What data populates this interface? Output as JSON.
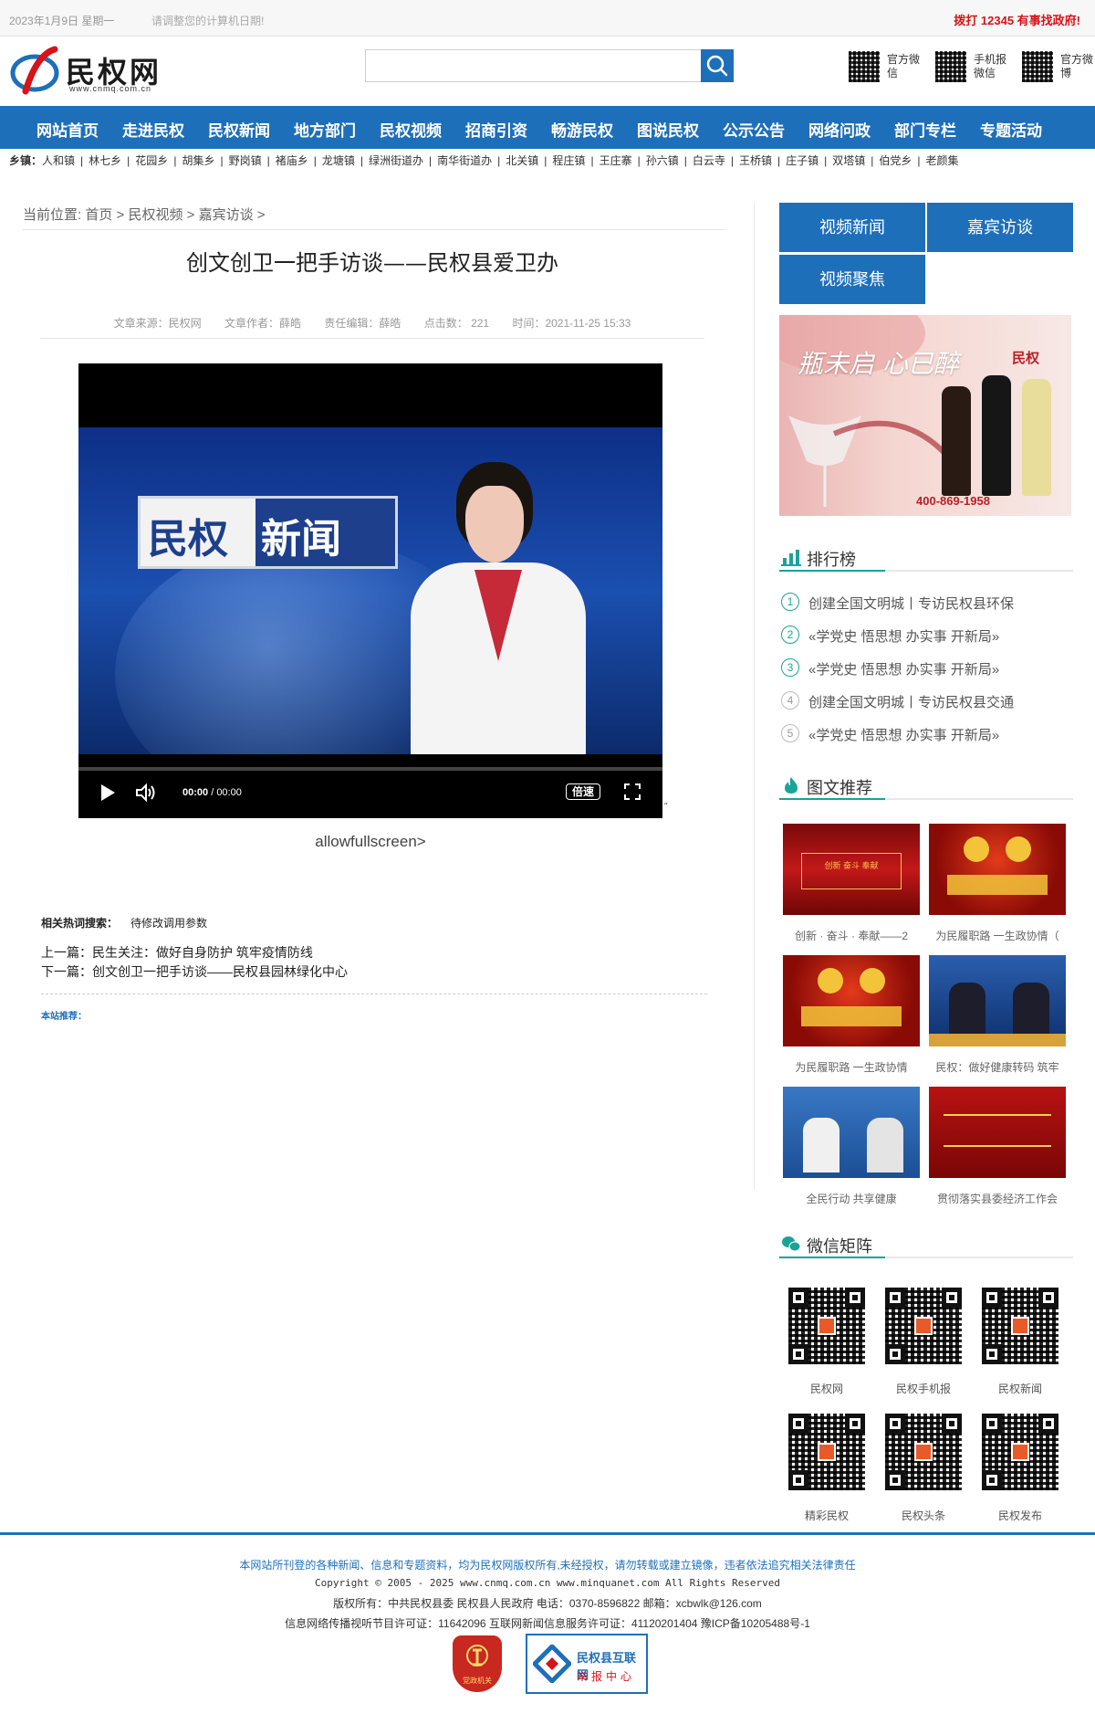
{
  "topbar": {
    "date": "2023年1月9日 星期一",
    "hint": "请调整您的计算机日期!",
    "hotline": "拨打 12345 有事找政府!"
  },
  "header": {
    "logo_text": "民权网",
    "logo_url": "www.cnmq.com.cn",
    "search_placeholder": "",
    "qr_links": [
      {
        "label": "官方微信"
      },
      {
        "label": "手机报微信"
      },
      {
        "label": "官方微博"
      }
    ]
  },
  "nav": {
    "items": [
      "网站首页",
      "走进民权",
      "民权新闻",
      "地方部门",
      "民权视频",
      "招商引资",
      "畅游民权",
      "图说民权",
      "公示公告",
      "网络问政",
      "部门专栏",
      "专题活动"
    ]
  },
  "towns": {
    "label": "乡镇：",
    "items": [
      "人和镇",
      "林七乡",
      "花园乡",
      "胡集乡",
      "野岗镇",
      "褚庙乡",
      "龙塘镇",
      "绿洲街道办",
      "南华街道办",
      "北关镇",
      "程庄镇",
      "王庄寨",
      "孙六镇",
      "白云寺",
      "王桥镇",
      "庄子镇",
      "双塔镇",
      "伯党乡",
      "老颜集"
    ]
  },
  "breadcrumb": {
    "prefix": "当前位置:",
    "items": [
      "首页",
      "民权视频",
      "嘉宾访谈"
    ]
  },
  "article": {
    "title": "创文创卫一把手访谈——民权县爱卫办",
    "meta": {
      "source": "文章来源：民权网",
      "author": "文章作者：薛皓",
      "editor": "责任编辑：薛皓",
      "clicks": "点击数： 221",
      "time": "时间：2021-11-25 15:33"
    },
    "video": {
      "news_left": "民权",
      "news_right": "新闻",
      "time_current": "00:00",
      "time_total": "/ 00:00",
      "speed_label": "倍速",
      "progress": 0
    },
    "stray_char": "\"",
    "allowfullscreen_text": "allowfullscreen>",
    "hot_label": "相关热词搜索：",
    "hot_value": "待修改调用参数",
    "prev": "上一篇：民生关注：做好自身防护 筑牢疫情防线",
    "next": "下一篇：创文创卫一把手访谈——民权县园林绿化中心",
    "recommend_label": "本站推荐："
  },
  "sidebar": {
    "tabs": [
      "视频新闻",
      "嘉宾访谈",
      "视频聚焦"
    ],
    "ad": {
      "slogan": "瓶未启 心已醉",
      "brand": "民权",
      "tel": "400-869-1958"
    },
    "ranking": {
      "title": "排行榜",
      "items": [
        {
          "num": "1",
          "text": "创建全国文明城丨专访民权县环保"
        },
        {
          "num": "2",
          "text": "«学党史 悟思想 办实事 开新局»"
        },
        {
          "num": "3",
          "text": "«学党史 悟思想 办实事 开新局»"
        },
        {
          "num": "4",
          "text": "创建全国文明城丨专访民权县交通"
        },
        {
          "num": "5",
          "text": "«学党史 悟思想 办实事 开新局»"
        }
      ]
    },
    "pictures": {
      "title": "图文推荐",
      "items": [
        {
          "caption": "创新 · 奋斗 · 奉献——2"
        },
        {
          "caption": "为民履职路 一生政协情（"
        },
        {
          "caption": "为民履职路 一生政协情"
        },
        {
          "caption": "民权：做好健康转码 筑牢"
        },
        {
          "caption": "全民行动 共享健康"
        },
        {
          "caption": "贯彻落实县委经济工作会"
        }
      ]
    },
    "wechat": {
      "title": "微信矩阵",
      "items": [
        "民权网",
        "民权手机报",
        "民权新闻",
        "精彩民权",
        "民权头条",
        "民权发布"
      ]
    }
  },
  "footer": {
    "notice": "本网站所刊登的各种新闻、信息和专题资料，均为民权网版权所有,未经授权，请勿转载或建立镜像，违者依法追究相关法律责任",
    "copyright": "Copyright © 2005 - 2025 www.cnmq.com.cn www.minquanet.com All Rights Reserved",
    "owner": "版权所有：中共民权县委 民权县人民政府 电话：0370-8596822 邮箱：xcbwlk@126.com",
    "license": "信息网络传播视听节目许可证：11642096 互联网新闻信息服务许可证：41120201404 豫ICP备10205488号-1",
    "badge1": "党政机关",
    "badge2_title": "民权县互联网",
    "badge2_sub": "举报中心"
  },
  "colors": {
    "brand_blue": "#1e6fba",
    "accent_teal": "#1aa39a",
    "alert_red": "#d71318"
  }
}
